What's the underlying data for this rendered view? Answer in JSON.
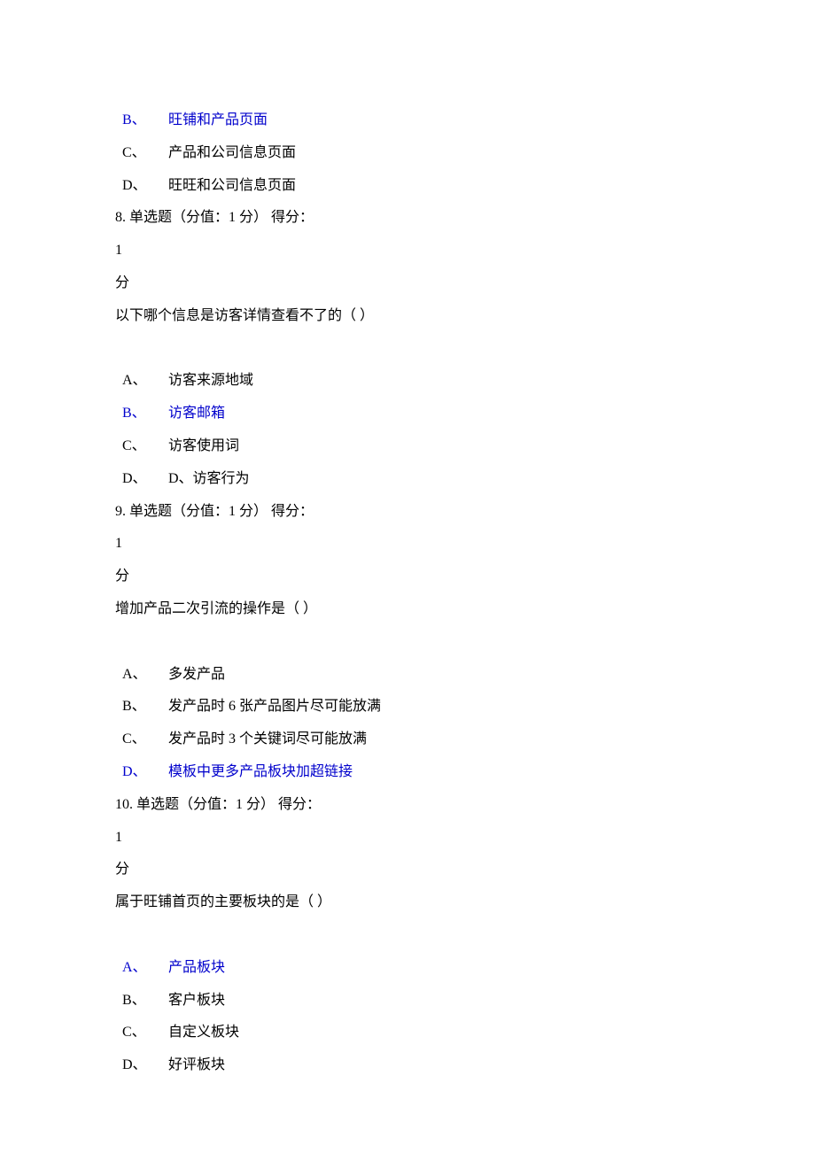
{
  "q7": {
    "optB": {
      "letter": "B、",
      "text": "旺铺和产品页面"
    },
    "optC": {
      "letter": "C、",
      "text": "产品和公司信息页面"
    },
    "optD": {
      "letter": "D、",
      "text": "旺旺和公司信息页面"
    }
  },
  "q8": {
    "header": "8. 单选题（分值：1 分）  得分：",
    "scoreNum": "1",
    "scoreUnit": " 分",
    "stem": "以下哪个信息是访客详情查看不了的（  ）",
    "optA": {
      "letter": "A、",
      "text": "访客来源地域"
    },
    "optB": {
      "letter": "B、",
      "text": "访客邮箱"
    },
    "optC": {
      "letter": "C、",
      "text": "访客使用词"
    },
    "optD": {
      "letter": "D、",
      "text": "D、访客行为"
    }
  },
  "q9": {
    "header": "9. 单选题（分值：1 分）  得分：",
    "scoreNum": "1",
    "scoreUnit": " 分",
    "stem": "增加产品二次引流的操作是（  ）",
    "optA": {
      "letter": "A、",
      "text": "多发产品"
    },
    "optB": {
      "letter": "B、",
      "text": "发产品时 6 张产品图片尽可能放满"
    },
    "optC": {
      "letter": "C、",
      "text": "发产品时 3 个关键词尽可能放满"
    },
    "optD": {
      "letter": "D、",
      "text": "模板中更多产品板块加超链接"
    }
  },
  "q10": {
    "header": "10. 单选题（分值：1 分）  得分：",
    "scoreNum": "1",
    "scoreUnit": " 分",
    "stem": "属于旺铺首页的主要板块的是（  ）",
    "optA": {
      "letter": "A、",
      "text": "产品板块"
    },
    "optB": {
      "letter": "B、",
      "text": "客户板块"
    },
    "optC": {
      "letter": "C、",
      "text": "自定义板块"
    },
    "optD": {
      "letter": "D、",
      "text": "好评板块"
    }
  }
}
